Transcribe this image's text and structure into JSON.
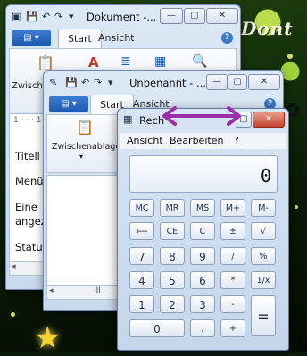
{
  "wallpaper": {
    "title": "Dont",
    "accent": "#b9dd4a"
  },
  "window1": {
    "title": "Dokument -...",
    "tabs": {
      "start": "Start",
      "view": "Ansicht"
    },
    "ribbon_label": "Zwische",
    "ruler": "1 · · · 1",
    "doc_lines": [
      "Titell",
      "Menü",
      "Eine",
      "angez",
      "Statu"
    ]
  },
  "window2": {
    "title": "Unbenannt - ...",
    "tabs": {
      "start": "Start",
      "view": "Ansicht"
    },
    "ribbon_label": "Zwischenablage",
    "scroll_label": "III"
  },
  "calculator": {
    "title": "Rech",
    "menu": [
      "Ansicht",
      "Bearbeiten",
      "?"
    ],
    "display_value": "0",
    "keys": {
      "mc": "MC",
      "mr": "MR",
      "ms": "MS",
      "mplus": "M+",
      "mminus": "M-",
      "back": "⟵",
      "ce": "CE",
      "c": "C",
      "plusminus": "±",
      "sqrt": "√",
      "n7": "7",
      "n8": "8",
      "n9": "9",
      "div": "/",
      "pct": "%",
      "n4": "4",
      "n5": "5",
      "n6": "6",
      "mul": "*",
      "recip": "1/x",
      "n1": "1",
      "n2": "2",
      "n3": "3",
      "minus": "-",
      "eq": "=",
      "n0": "0",
      "dot": ",",
      "plus": "+"
    }
  },
  "annotation": {
    "arrow_color": "#9b2fa8"
  }
}
